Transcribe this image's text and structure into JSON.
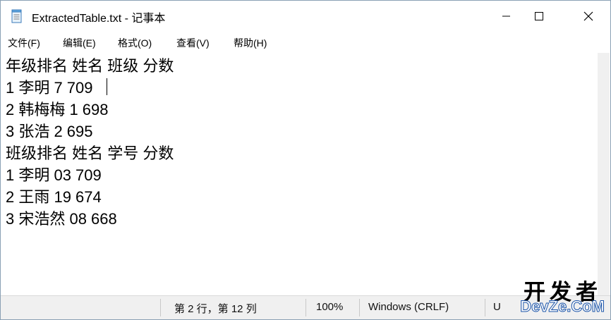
{
  "window": {
    "title": "ExtractedTable.txt - 记事本"
  },
  "menu": {
    "items": [
      "文件(F)",
      "编辑(E)",
      "格式(O)",
      "查看(V)",
      "帮助(H)"
    ]
  },
  "document": {
    "lines": [
      "年级排名 姓名 班级 分数",
      "1 李明 7 709",
      "2 韩梅梅 1 698",
      "3 张浩 2 695",
      "班级排名 姓名 学号 分数",
      "1 李明 03 709",
      "2 王雨 19 674",
      "3 宋浩然 08 668"
    ]
  },
  "status": {
    "position": "第 2 行，第 12 列",
    "zoom": "100%",
    "line_ending": "Windows (CRLF)",
    "encoding_partial": "U"
  },
  "watermark": {
    "top": "开发者",
    "bottom": "DevZe.CoM"
  },
  "icons": {
    "app": "notepad-icon",
    "minimize": "minimize-icon",
    "maximize": "maximize-icon",
    "close": "close-icon"
  },
  "colors": {
    "status_bar_bg": "#f0f0f0",
    "watermark_blue": "#1a53a8"
  }
}
